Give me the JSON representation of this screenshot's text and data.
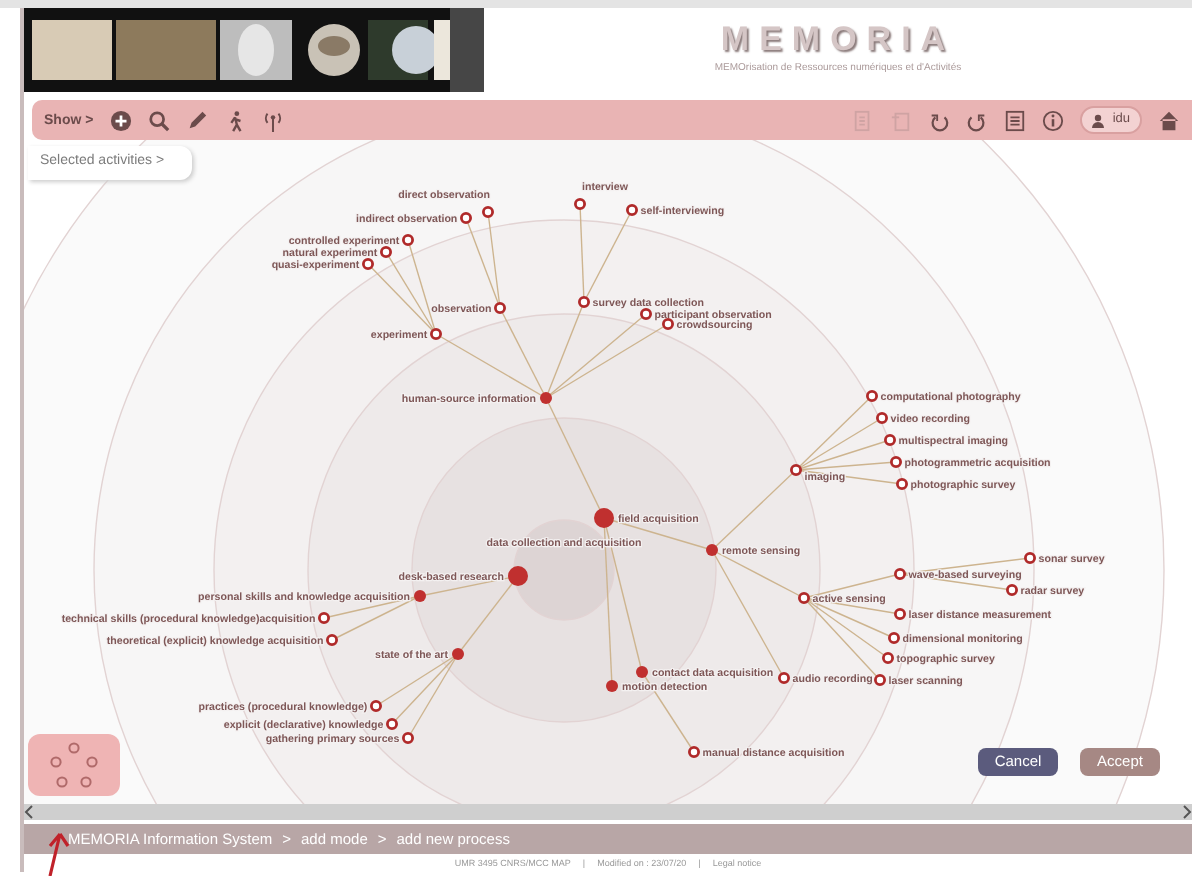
{
  "header": {
    "title": "MEMORIA",
    "subtitle": "MEMOrisation de Ressources numériques et d'Activités"
  },
  "toolbar": {
    "show_button": "Show >",
    "user_button": "idu"
  },
  "selected_activities": "Selected activities >",
  "diagram": {
    "root": "data collection and acquisition",
    "children": [
      {
        "label": "field acquisition",
        "kind": "domain",
        "children": [
          {
            "label": "human-source information",
            "kind": "category",
            "children": [
              {
                "label": "experiment",
                "kind": "activity",
                "children": [
                  {
                    "label": "controlled experiment",
                    "kind": "activity"
                  },
                  {
                    "label": "natural experiment",
                    "kind": "activity"
                  },
                  {
                    "label": "quasi-experiment",
                    "kind": "activity"
                  }
                ]
              },
              {
                "label": "observation",
                "kind": "activity",
                "children": [
                  {
                    "label": "direct observation",
                    "kind": "activity"
                  },
                  {
                    "label": "indirect observation",
                    "kind": "activity"
                  }
                ]
              },
              {
                "label": "survey data collection",
                "kind": "activity",
                "children": [
                  {
                    "label": "interview",
                    "kind": "activity"
                  },
                  {
                    "label": "self-interviewing",
                    "kind": "activity"
                  }
                ]
              },
              {
                "label": "participant observation",
                "kind": "activity"
              },
              {
                "label": "crowdsourcing",
                "kind": "activity"
              }
            ]
          },
          {
            "label": "remote sensing",
            "kind": "category",
            "children": [
              {
                "label": "imaging",
                "kind": "activity",
                "children": [
                  {
                    "label": "computational photography",
                    "kind": "activity"
                  },
                  {
                    "label": "video recording",
                    "kind": "activity"
                  },
                  {
                    "label": "multispectral imaging",
                    "kind": "activity"
                  },
                  {
                    "label": "photogrammetric acquisition",
                    "kind": "activity"
                  },
                  {
                    "label": "photographic survey",
                    "kind": "activity"
                  }
                ]
              },
              {
                "label": "active sensing",
                "kind": "activity",
                "children": [
                  {
                    "label": "wave-based surveying",
                    "kind": "activity",
                    "children": [
                      {
                        "label": "sonar survey",
                        "kind": "activity"
                      },
                      {
                        "label": "radar survey",
                        "kind": "activity"
                      }
                    ]
                  },
                  {
                    "label": "laser distance measurement",
                    "kind": "activity"
                  },
                  {
                    "label": "dimensional monitoring",
                    "kind": "activity"
                  },
                  {
                    "label": "topographic survey",
                    "kind": "activity"
                  },
                  {
                    "label": "laser scanning",
                    "kind": "activity"
                  }
                ]
              },
              {
                "label": "audio recording",
                "kind": "activity"
              }
            ]
          },
          {
            "label": "contact data acquisition",
            "kind": "category",
            "children": [
              {
                "label": "manual distance acquisition",
                "kind": "activity"
              }
            ]
          },
          {
            "label": "motion detection",
            "kind": "category"
          }
        ]
      },
      {
        "label": "desk-based research",
        "kind": "domain",
        "children": [
          {
            "label": "personal skills and knowledge acquisition",
            "kind": "category",
            "children": [
              {
                "label": "technical skills (procedural knowledge)acquisition",
                "kind": "activity"
              },
              {
                "label": "theoretical (explicit) knowledge acquisition",
                "kind": "activity"
              }
            ]
          },
          {
            "label": "state of the art",
            "kind": "category",
            "children": [
              {
                "label": "practices (procedural knowledge)",
                "kind": "activity"
              },
              {
                "label": "explicit (declarative) knowledge",
                "kind": "activity"
              },
              {
                "label": "gathering primary sources",
                "kind": "activity"
              }
            ]
          }
        ]
      }
    ]
  },
  "cancel_button": "Cancel",
  "accept_button": "Accept",
  "breadcrumb": {
    "separator": ">",
    "items": [
      "MEMORIA  Information System",
      "add mode",
      "add new process"
    ]
  },
  "footer": {
    "separator": "|",
    "items": [
      "UMR 3495 CNRS/MCC MAP",
      "Modified on : 23/07/20",
      "Legal notice"
    ]
  }
}
